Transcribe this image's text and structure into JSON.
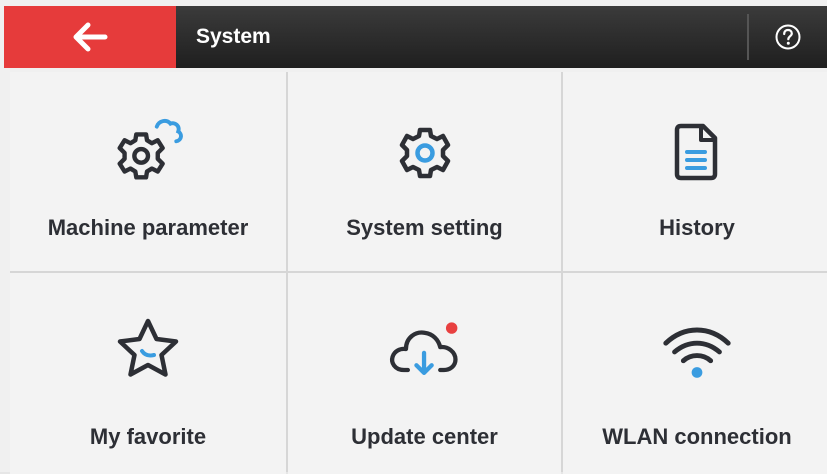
{
  "header": {
    "title": "System",
    "back_icon": "arrow-left-icon",
    "help_icon": "question-circle-icon",
    "accent_color": "#e63b3b"
  },
  "menu": {
    "items": [
      {
        "label": "Machine parameter",
        "icon": "gear-cloud-icon"
      },
      {
        "label": "System setting",
        "icon": "gear-icon"
      },
      {
        "label": "History",
        "icon": "document-icon"
      },
      {
        "label": "My favorite",
        "icon": "star-icon"
      },
      {
        "label": "Update center",
        "icon": "cloud-download-icon",
        "badge": "notification-dot"
      },
      {
        "label": "WLAN connection",
        "icon": "wifi-icon"
      }
    ],
    "icon_color": "#2d2f35",
    "accent_color": "#3a9ce0",
    "badge_color": "#e84040"
  }
}
